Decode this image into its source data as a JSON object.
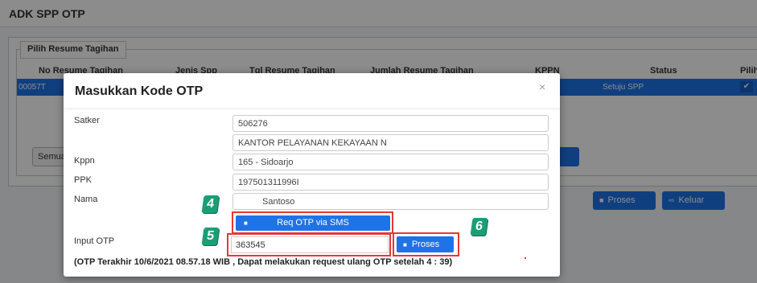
{
  "page": {
    "title": "ADK SPP OTP"
  },
  "resume_panel": {
    "legend": "Pilih Resume Tagihan",
    "columns": [
      "No Resume Tagihan",
      "Jenis Spp",
      "Tgl Resume Tagihan",
      "Jumlah Resume Tagihan",
      "KPPN",
      "Status",
      "Pilih"
    ],
    "selected_row": {
      "no_resume": "00057T",
      "status": "Setuju SPP",
      "check": "✔"
    },
    "semua_label": "Semua",
    "proses_label": "Proses",
    "keluar_label": "Keluar"
  },
  "modal": {
    "title": "Masukkan Kode OTP",
    "close_glyph": "×",
    "satker_label": "Satker",
    "satker_code": "506276",
    "satker_name": "KANTOR PELAYANAN KEKAYAAN N",
    "kppn_label": "Kppn",
    "kppn_value": "165 - Sidoarjo",
    "ppk_label": "PPK",
    "ppk_value": "197501311996I",
    "nama_label": "Nama",
    "nama_value": "Santoso",
    "req_otp_label": "Req OTP via SMS",
    "input_otp_label": "Input OTP",
    "otp_value": "363545",
    "proses_label": "Proses",
    "note": "(OTP Terakhir 10/6/2021 08.57.18 WIB , Dapat melakukan request ulang OTP setelah 4 : 39)"
  },
  "steps": [
    "4",
    "5",
    "6"
  ],
  "colors": {
    "primary": "#1e73e8",
    "highlight": "#e53935",
    "step_marker": "#1b9e77"
  },
  "icons": {
    "floppy": "floppy-disk-icon",
    "exit": "sign-out-icon"
  }
}
